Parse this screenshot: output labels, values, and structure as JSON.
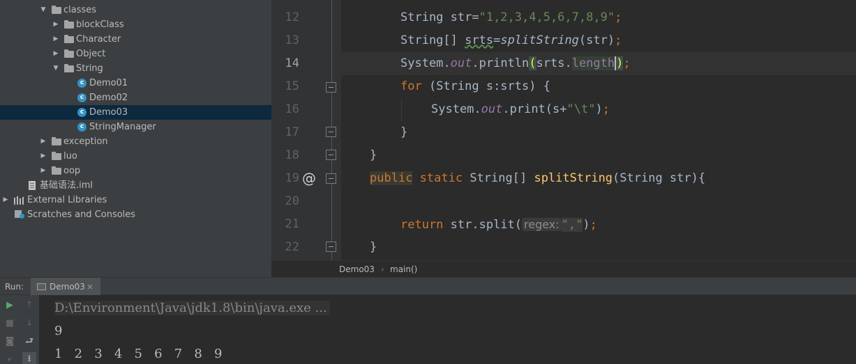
{
  "project_tree": [
    {
      "label": "classes",
      "type": "folder",
      "expanded": true
    },
    {
      "label": "blockClass",
      "type": "folder",
      "expanded": false
    },
    {
      "label": "Character",
      "type": "folder",
      "expanded": false
    },
    {
      "label": "Object",
      "type": "folder",
      "expanded": false
    },
    {
      "label": "String",
      "type": "folder",
      "expanded": true
    },
    {
      "label": "Demo01",
      "type": "class"
    },
    {
      "label": "Demo02",
      "type": "class"
    },
    {
      "label": "Demo03",
      "type": "class",
      "selected": true
    },
    {
      "label": "StringManager",
      "type": "class"
    },
    {
      "label": "exception",
      "type": "folder",
      "expanded": false
    },
    {
      "label": "luo",
      "type": "folder",
      "expanded": false
    },
    {
      "label": "oop",
      "type": "folder",
      "expanded": false
    },
    {
      "label": "基础语法.iml",
      "type": "file"
    },
    {
      "label": "External Libraries",
      "type": "library",
      "expanded": false
    },
    {
      "label": "Scratches and Consoles",
      "type": "scratches"
    }
  ],
  "editor": {
    "line_numbers": [
      "12",
      "13",
      "14",
      "15",
      "16",
      "17",
      "18",
      "19",
      "20",
      "21",
      "22"
    ],
    "current_line": "14",
    "lines": {
      "l12": {
        "a": "String str=",
        "b": "\"1,2,3,4,5,6,7,8,9\"",
        "c": ";"
      },
      "l13": {
        "a": "String[] ",
        "b": "srts",
        "c": "=",
        "d": "splitString",
        "e": "(str)",
        "f": ";"
      },
      "l14": {
        "a": "System.",
        "b": "out",
        "c": ".println",
        "d": "(",
        "e": "srts.",
        "f": "length",
        "g": ")",
        "h": ";"
      },
      "l15": {
        "a": "for",
        "b": " (String s:srts) {"
      },
      "l16": {
        "a": "System.",
        "b": "out",
        "c": ".print(s+",
        "d": "\"\\t\"",
        "e": ")",
        "f": ";"
      },
      "l17": {
        "a": "}"
      },
      "l18": {
        "a": "}"
      },
      "l19": {
        "a": "public",
        "b": " ",
        "c": "static",
        "d": " String[] ",
        "e": "splitString",
        "f": "(String str){"
      },
      "l20": {
        "a": ""
      },
      "l21": {
        "a": "return",
        "b": " str.split(",
        "c": "regex:",
        "d": "\",\"",
        "e": ")",
        "f": ";"
      },
      "l22": {
        "a": "}"
      }
    },
    "override_marker": "@"
  },
  "breadcrumb": {
    "class": "Demo03",
    "separator": "›",
    "method": "main()"
  },
  "run_panel": {
    "label": "Run:",
    "tab": "Demo03",
    "close": "×",
    "console": {
      "command": "D:\\Environment\\Java\\jdk1.8\\bin\\java.exe ...",
      "line1": "9",
      "line2": "1   2   3   4   5   6   7   8   9"
    }
  }
}
